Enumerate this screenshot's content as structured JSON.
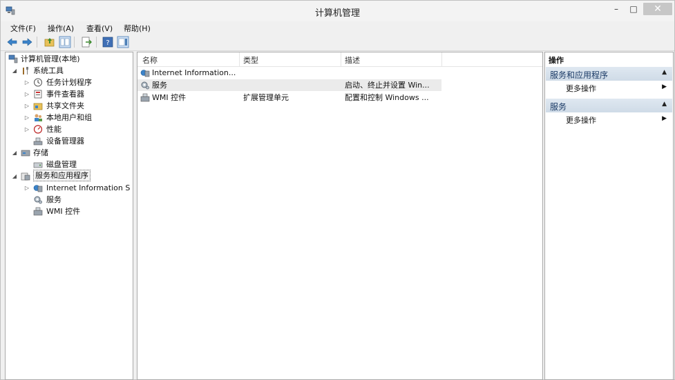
{
  "window": {
    "title": "计算机管理",
    "minimize": "–",
    "maximize": "□",
    "close": "✕"
  },
  "menu": [
    "文件(F)",
    "操作(A)",
    "查看(V)",
    "帮助(H)"
  ],
  "toolbar": {
    "buttons": [
      "back-icon",
      "forward-icon",
      "up-folder-icon",
      "show-hide-tree-icon",
      "export-list-icon",
      "help-icon",
      "show-hide-action-pane-icon"
    ]
  },
  "tree": {
    "root": "计算机管理(本地)",
    "system_tools": "系统工具",
    "task_scheduler": "任务计划程序",
    "event_viewer": "事件查看器",
    "shared_folders": "共享文件夹",
    "local_users": "本地用户和组",
    "performance": "性能",
    "device_manager": "设备管理器",
    "storage": "存储",
    "disk_management": "磁盘管理",
    "services_apps": "服务和应用程序",
    "iis": "Internet Information S",
    "services": "服务",
    "wmi": "WMI 控件"
  },
  "list": {
    "columns": [
      "名称",
      "类型",
      "描述"
    ],
    "rows": [
      {
        "name": "Internet Information...",
        "type": "",
        "desc": ""
      },
      {
        "name": "服务",
        "type": "",
        "desc": "启动、终止并设置 Win..."
      },
      {
        "name": "WMI 控件",
        "type": "扩展管理单元",
        "desc": "配置和控制 Windows ..."
      }
    ]
  },
  "actions": {
    "title": "操作",
    "sections": [
      {
        "label": "服务和应用程序",
        "item": "更多操作"
      },
      {
        "label": "服务",
        "item": "更多操作"
      }
    ]
  },
  "colors": {
    "accent_header": "#d6e1ec",
    "header_text": "#1a3a66"
  }
}
